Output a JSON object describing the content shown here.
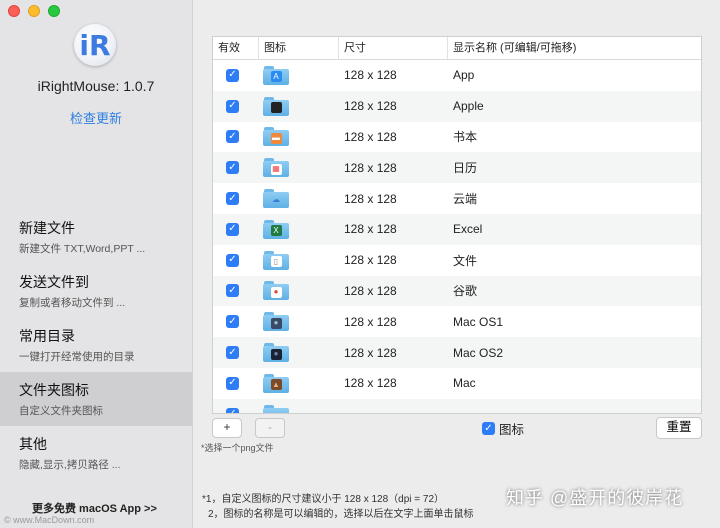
{
  "sidebar": {
    "app_icon_letter": "iR",
    "app_name": "iRightMouse: 1.0.7",
    "check_update": "检查更新",
    "items": [
      {
        "title": "新建文件",
        "sub": "新建文件 TXT,Word,PPT ..."
      },
      {
        "title": "发送文件到",
        "sub": "复制或者移动文件到 ..."
      },
      {
        "title": "常用目录",
        "sub": "一键打开经常使用的目录"
      },
      {
        "title": "文件夹图标",
        "sub": "自定义文件夹图标"
      },
      {
        "title": "其他",
        "sub": "隐藏,显示,拷贝路径 ..."
      }
    ],
    "active_index": 3,
    "more_apps": "更多免费 macOS App >>",
    "watermark": "© www.MacDown.com"
  },
  "table": {
    "headers": [
      "有效",
      "图标",
      "尺寸",
      "显示名称 (可编辑/可拖移)"
    ],
    "rows": [
      {
        "checked": true,
        "icon": "app-store-icon",
        "size": "128 x 128",
        "name": "App"
      },
      {
        "checked": true,
        "icon": "apple-icon",
        "size": "128 x 128",
        "name": "Apple"
      },
      {
        "checked": true,
        "icon": "book-icon",
        "size": "128 x 128",
        "name": "书本"
      },
      {
        "checked": true,
        "icon": "calendar-icon",
        "size": "128 x 128",
        "name": "日历"
      },
      {
        "checked": true,
        "icon": "cloud-icon",
        "size": "128 x 128",
        "name": "云端"
      },
      {
        "checked": true,
        "icon": "excel-icon",
        "size": "128 x 128",
        "name": "Excel"
      },
      {
        "checked": true,
        "icon": "document-icon",
        "size": "128 x 128",
        "name": "文件"
      },
      {
        "checked": true,
        "icon": "chrome-icon",
        "size": "128 x 128",
        "name": "谷歌"
      },
      {
        "checked": true,
        "icon": "macos-icon",
        "size": "128 x 128",
        "name": "Mac OS1"
      },
      {
        "checked": true,
        "icon": "macos-dark-icon",
        "size": "128 x 128",
        "name": "Mac OS2"
      },
      {
        "checked": true,
        "icon": "mac-landscape-icon",
        "size": "128 x 128",
        "name": "Mac"
      },
      {
        "checked": true,
        "icon": "folder-icon",
        "size": "",
        "name": ""
      }
    ]
  },
  "controls": {
    "add_label": "+",
    "remove_label": "-",
    "hint": "*选择一个png文件",
    "show_icon_label": "图标",
    "show_icon_checked": true,
    "reset_label": "重置"
  },
  "notes": {
    "line1": "*1，自定义图标的尺寸建议小于 128 x 128（dpi = 72）",
    "line2": "2，图标的名称是可以编辑的，选择以后在文字上面单击鼠标"
  },
  "overlay_watermark": "知乎 @盛开的彼岸花",
  "colors": {
    "accent": "#2e7cf6",
    "link": "#2f7fe0",
    "folder": "#6cb6e8"
  }
}
